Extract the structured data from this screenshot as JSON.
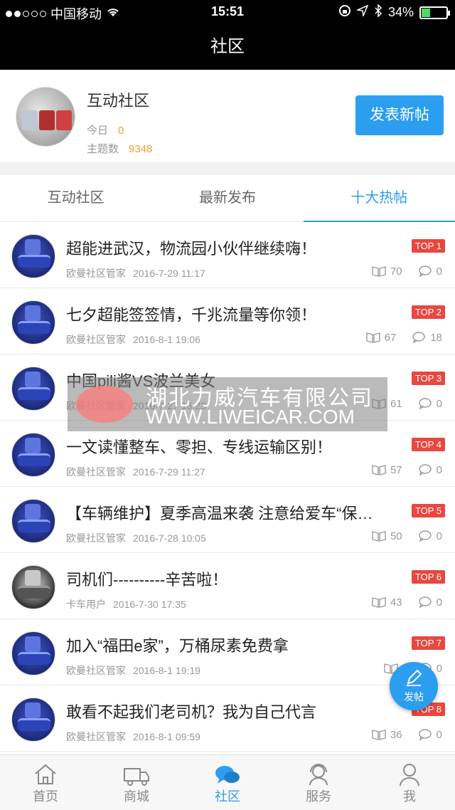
{
  "status": {
    "carrier": "中国移动",
    "time": "15:51",
    "battery": "34%",
    "battery_level": 0.34
  },
  "nav": {
    "title": "社区"
  },
  "profile": {
    "name": "互动社区",
    "today_label": "今日",
    "today_value": "0",
    "topics_label": "主题数",
    "topics_value": "9348",
    "post_button": "发表新帖"
  },
  "tabs": [
    {
      "label": "互动社区",
      "active": false
    },
    {
      "label": "最新发布",
      "active": false
    },
    {
      "label": "十大热帖",
      "active": true
    }
  ],
  "posts": [
    {
      "title": "超能进武汉，物流园小伙伴继续嗨！",
      "author": "欧曼社区管家",
      "date": "2016-7-29 11:17",
      "badge": "TOP 1",
      "reads": "70",
      "comments": "0"
    },
    {
      "title": "七夕超能签签情，千兆流量等你领！",
      "author": "欧曼社区管家",
      "date": "2016-8-1 19:06",
      "badge": "TOP 2",
      "reads": "67",
      "comments": "18"
    },
    {
      "title": "中国pili酱VS波兰美女",
      "author": "欧曼社区管家",
      "date": "2016-7-27 16:23",
      "badge": "TOP 3",
      "reads": "61",
      "comments": "0"
    },
    {
      "title": "一文读懂整车、零担、专线运输区别！",
      "author": "欧曼社区管家",
      "date": "2016-7-29 11:27",
      "badge": "TOP 4",
      "reads": "57",
      "comments": "0"
    },
    {
      "title": "【车辆维护】夏季高温来袭 注意给爱车“保…",
      "author": "欧曼社区管家",
      "date": "2016-7-28 10:05",
      "badge": "TOP 5",
      "reads": "50",
      "comments": "0"
    },
    {
      "title": "司机们----------辛苦啦！",
      "author": "卡车用户",
      "date": "2016-7-30 17:35",
      "badge": "TOP 6",
      "reads": "43",
      "comments": "0"
    },
    {
      "title": "加入“福田e家”，万桶尿素免费拿",
      "author": "欧曼社区管家",
      "date": "2016-8-1 19:19",
      "badge": "TOP 7",
      "reads": "",
      "comments": "0"
    },
    {
      "title": "敢看不起我们老司机？我为自己代言",
      "author": "欧曼社区管家",
      "date": "2016-8-1 09:59",
      "badge": "TOP 8",
      "reads": "36",
      "comments": "0"
    }
  ],
  "fab": {
    "label": "发帖"
  },
  "tabbar": [
    {
      "label": "首页",
      "icon": "home-icon"
    },
    {
      "label": "商城",
      "icon": "truck-icon"
    },
    {
      "label": "社区",
      "icon": "chat-icon"
    },
    {
      "label": "服务",
      "icon": "service-icon"
    },
    {
      "label": "我",
      "icon": "user-icon"
    }
  ],
  "watermark": {
    "line1": "湖北力威汽车有限公司",
    "line2": "WWW.LIWEICAR.COM"
  },
  "colors": {
    "accent": "#2b9ef0",
    "badge": "#e9473f",
    "highlight": "#e6a23c"
  }
}
